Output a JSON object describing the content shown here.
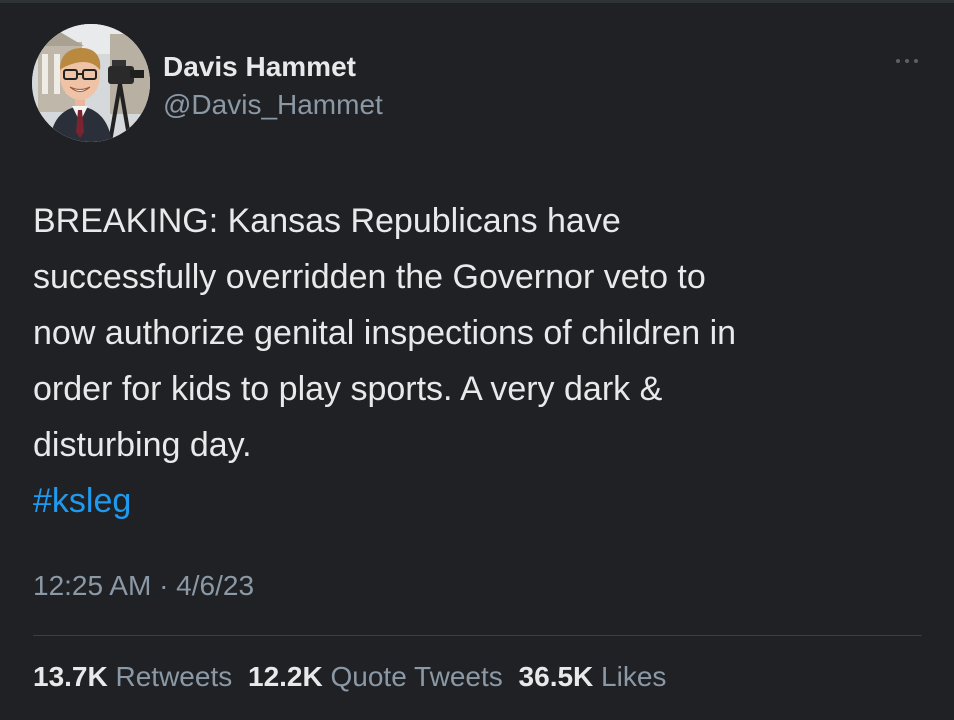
{
  "tweet": {
    "author": {
      "name": "Davis Hammet",
      "handle": "@Davis_Hammet",
      "avatar": "avatar-photo-man-with-camera"
    },
    "menu_icon": "more-horizontal-icon",
    "text_lines": [
      "BREAKING: Kansas Republicans have",
      "successfully overridden the Governor veto to",
      "now authorize genital inspections of children in",
      "order for kids to play sports. A very dark &",
      "disturbing day."
    ],
    "hashtag": "#ksleg",
    "timestamp": "12:25 AM · 4/6/23",
    "stats": {
      "retweets": {
        "count": "13.7K",
        "label": "Retweets"
      },
      "quote_tweets": {
        "count": "12.2K",
        "label": "Quote Tweets"
      },
      "likes": {
        "count": "36.5K",
        "label": "Likes"
      }
    }
  },
  "colors": {
    "background": "#202124",
    "primary_text": "#e7e9ea",
    "secondary_text": "#8b98a5",
    "link": "#1d9bf0"
  }
}
